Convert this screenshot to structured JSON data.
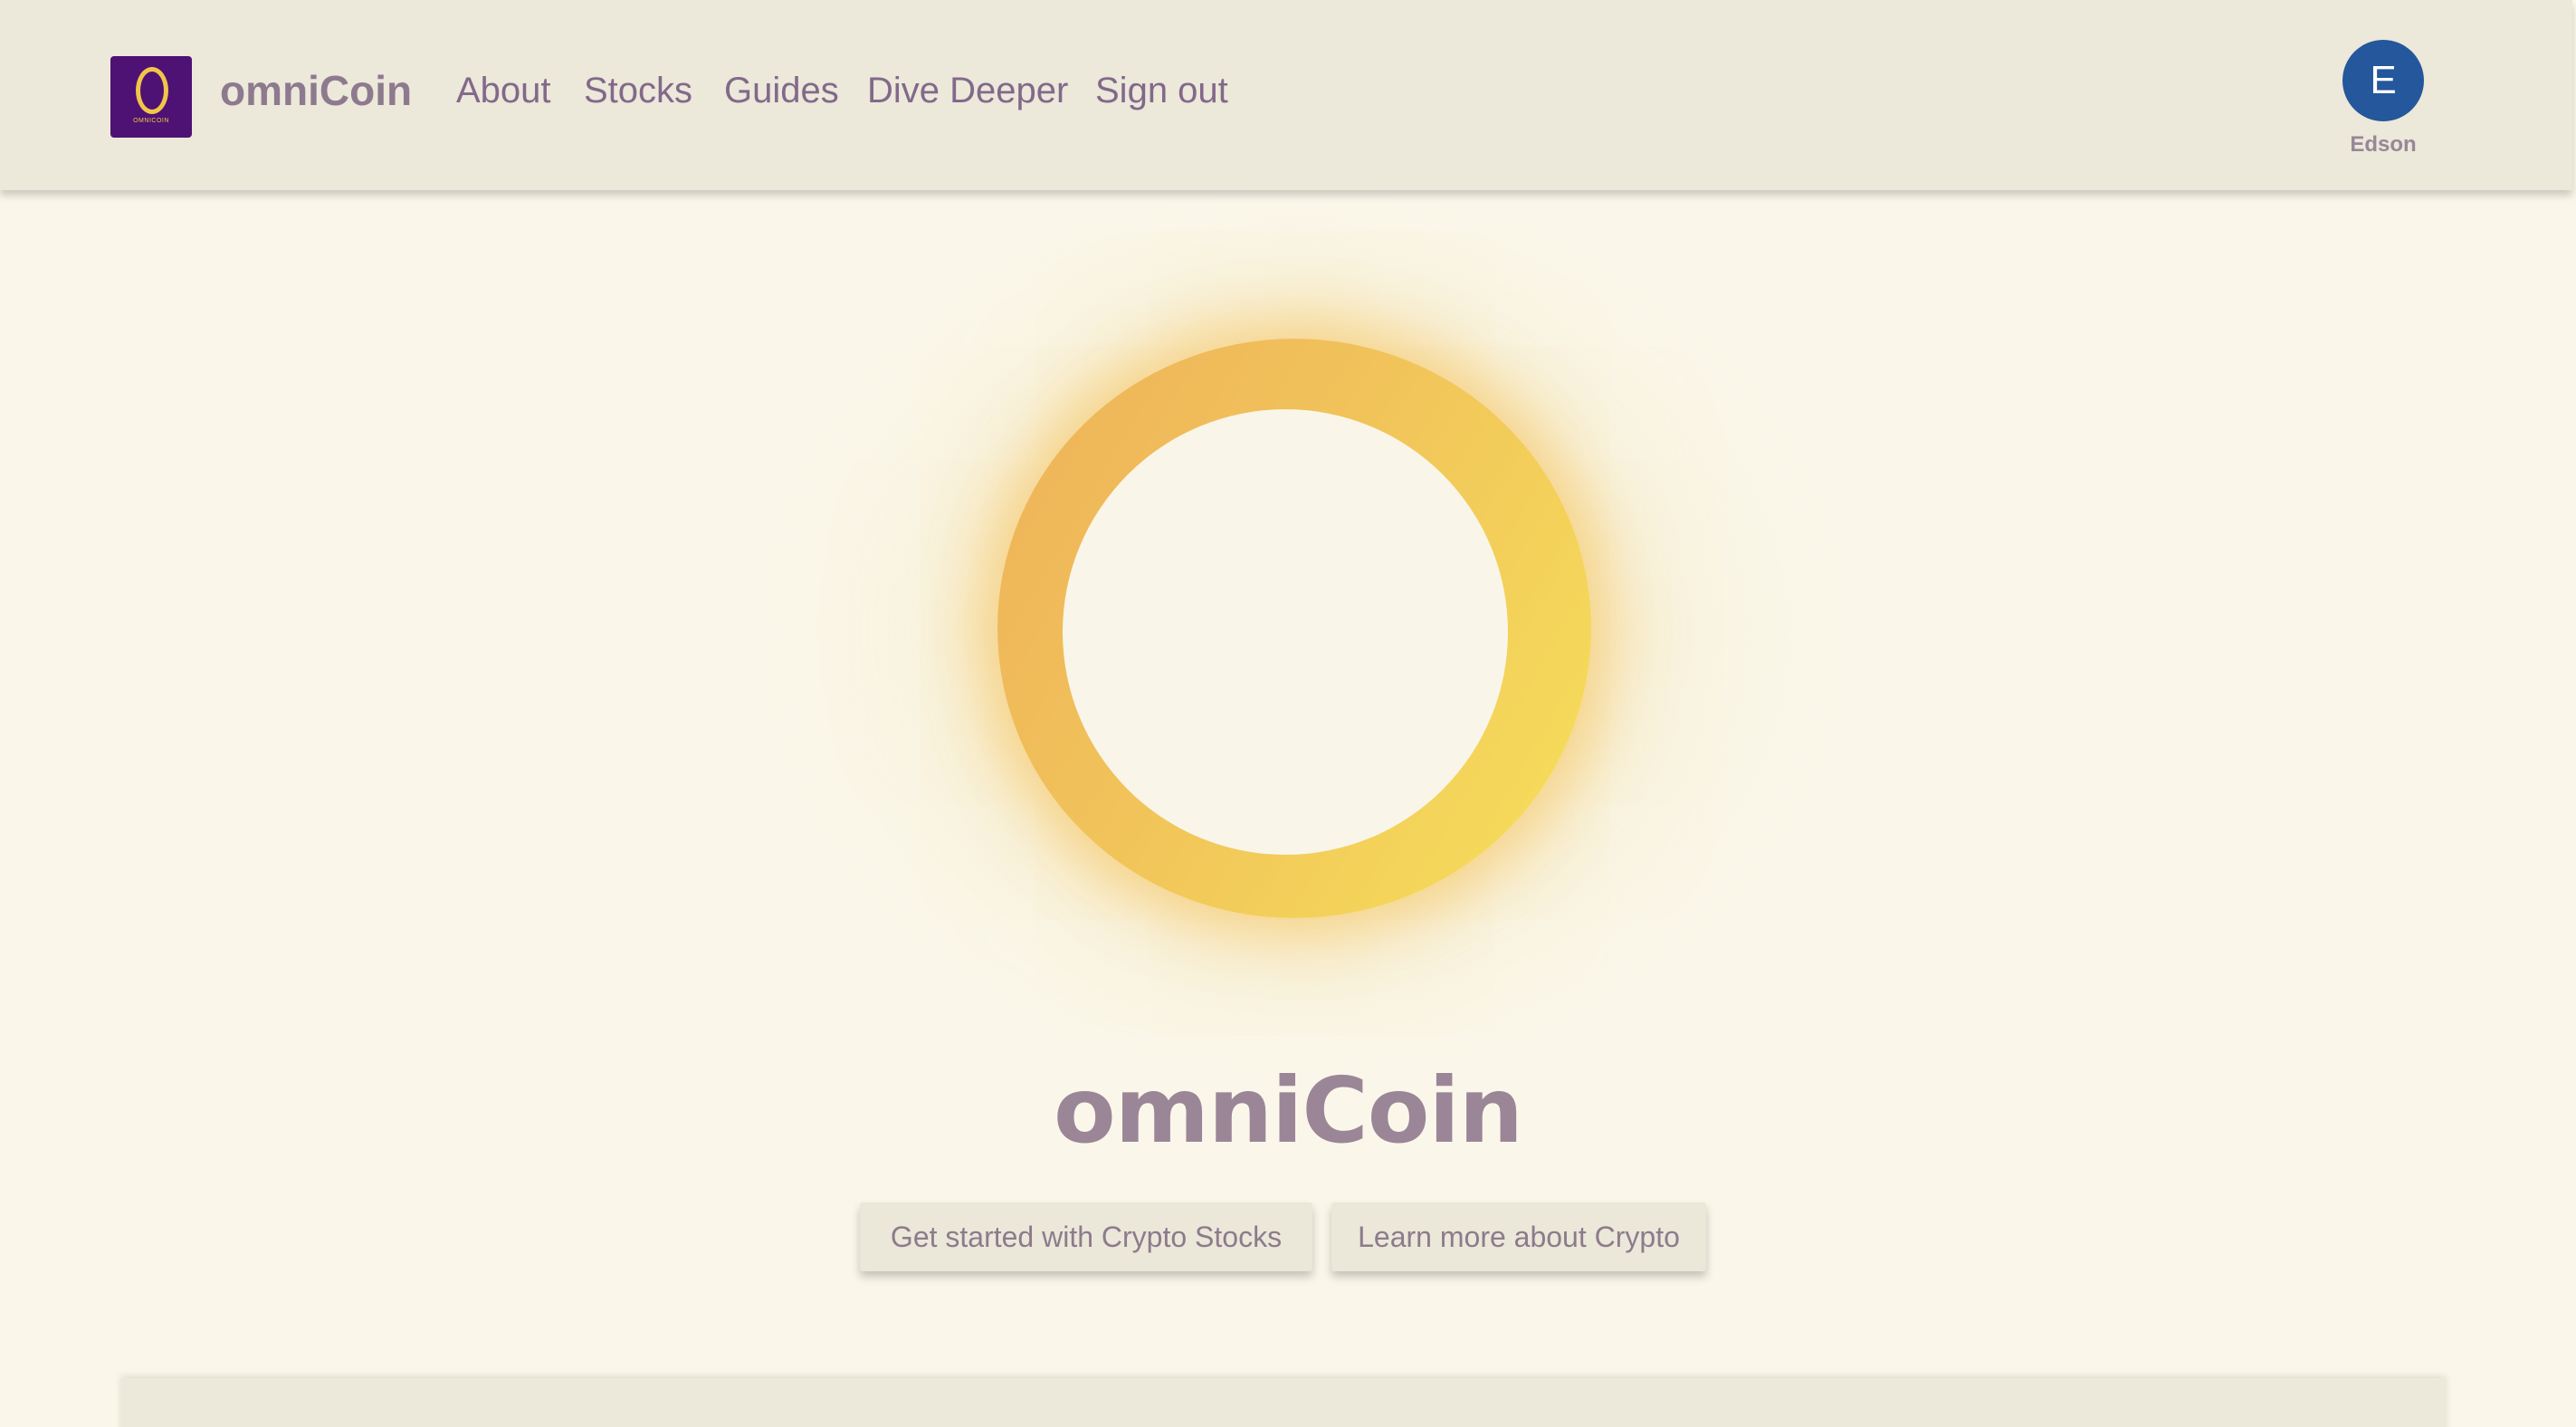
{
  "header": {
    "logo_text": "OMNICOIN",
    "brand": "omniCoin",
    "nav": [
      "About",
      "Stocks",
      "Guides",
      "Dive Deeper",
      "Sign out"
    ],
    "user": {
      "initial": "E",
      "name": "Edson"
    }
  },
  "hero": {
    "title": "omniCoin",
    "buttons": {
      "primary": "Get started with Crypto Stocks",
      "secondary": "Learn more about Crypto"
    }
  },
  "colors": {
    "header_bg": "#ece8da",
    "page_bg": "#faf7ea",
    "logo_bg": "#4d1273",
    "coin_orange": "#eeb159",
    "coin_yellow": "#f6e05a",
    "avatar_bg": "#24579c",
    "text_muted_purple": "#82698a"
  }
}
